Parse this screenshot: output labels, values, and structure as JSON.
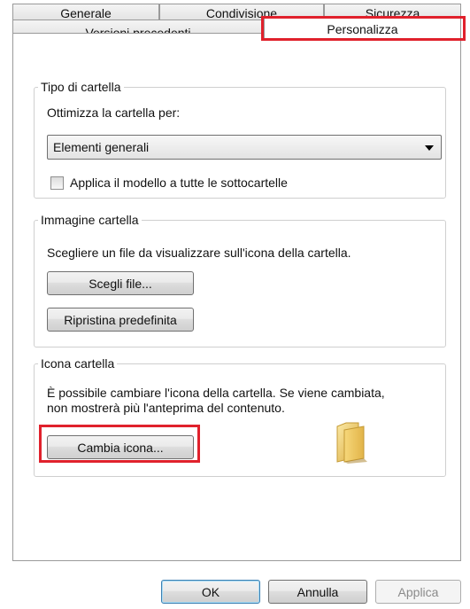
{
  "tabs": {
    "row1": [
      {
        "label": "Generale"
      },
      {
        "label": "Condivisione"
      },
      {
        "label": "Sicurezza"
      }
    ],
    "row2": [
      {
        "label": "Versioni precedenti"
      },
      {
        "label": "Personalizza",
        "selected": true
      }
    ]
  },
  "folder_type": {
    "legend": "Tipo di cartella",
    "optimize_label": "Ottimizza la cartella per:",
    "selected_option": "Elementi generali",
    "apply_checkbox_label": "Applica il modello a tutte le sottocartelle",
    "apply_checked": false
  },
  "folder_image": {
    "legend": "Immagine cartella",
    "description": "Scegliere un file da visualizzare sull'icona della cartella.",
    "choose_file_button": "Scegli file...",
    "restore_default_button": "Ripristina predefinita"
  },
  "folder_icon": {
    "legend": "Icona cartella",
    "description_line1": "È possibile cambiare l'icona della cartella. Se viene cambiata,",
    "description_line2": "non mostrerà più l'anteprima del contenuto.",
    "change_icon_button": "Cambia icona...",
    "icon": "folder-icon"
  },
  "footer": {
    "ok_button": "OK",
    "cancel_button": "Annulla",
    "apply_button": "Applica"
  },
  "colors": {
    "highlight": "#e0212c",
    "folder": "#f0d066"
  }
}
